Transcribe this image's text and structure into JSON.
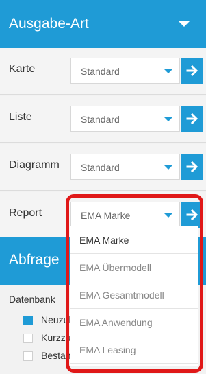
{
  "header": {
    "title": "Ausgabe-Art"
  },
  "rows": [
    {
      "label": "Karte",
      "value": "Standard"
    },
    {
      "label": "Liste",
      "value": "Standard"
    },
    {
      "label": "Diagramm",
      "value": "Standard"
    },
    {
      "label": "Report",
      "value": "EMA Marke"
    }
  ],
  "abfrage": {
    "title": "Abfrage"
  },
  "datenbank": {
    "label": "Datenbank",
    "items": [
      {
        "label": "Neuzulassungen",
        "checked": true
      },
      {
        "label": "Kurzzulassungen",
        "checked": false
      },
      {
        "label": "Bestand",
        "checked": false
      }
    ]
  },
  "report_dropdown": {
    "options": [
      "EMA Marke",
      "EMA Übermodell",
      "EMA Gesamtmodell",
      "EMA Anwendung",
      "EMA Leasing"
    ],
    "selected": "EMA Marke"
  },
  "colors": {
    "accent": "#1f9bd6",
    "highlight": "#e01818"
  }
}
